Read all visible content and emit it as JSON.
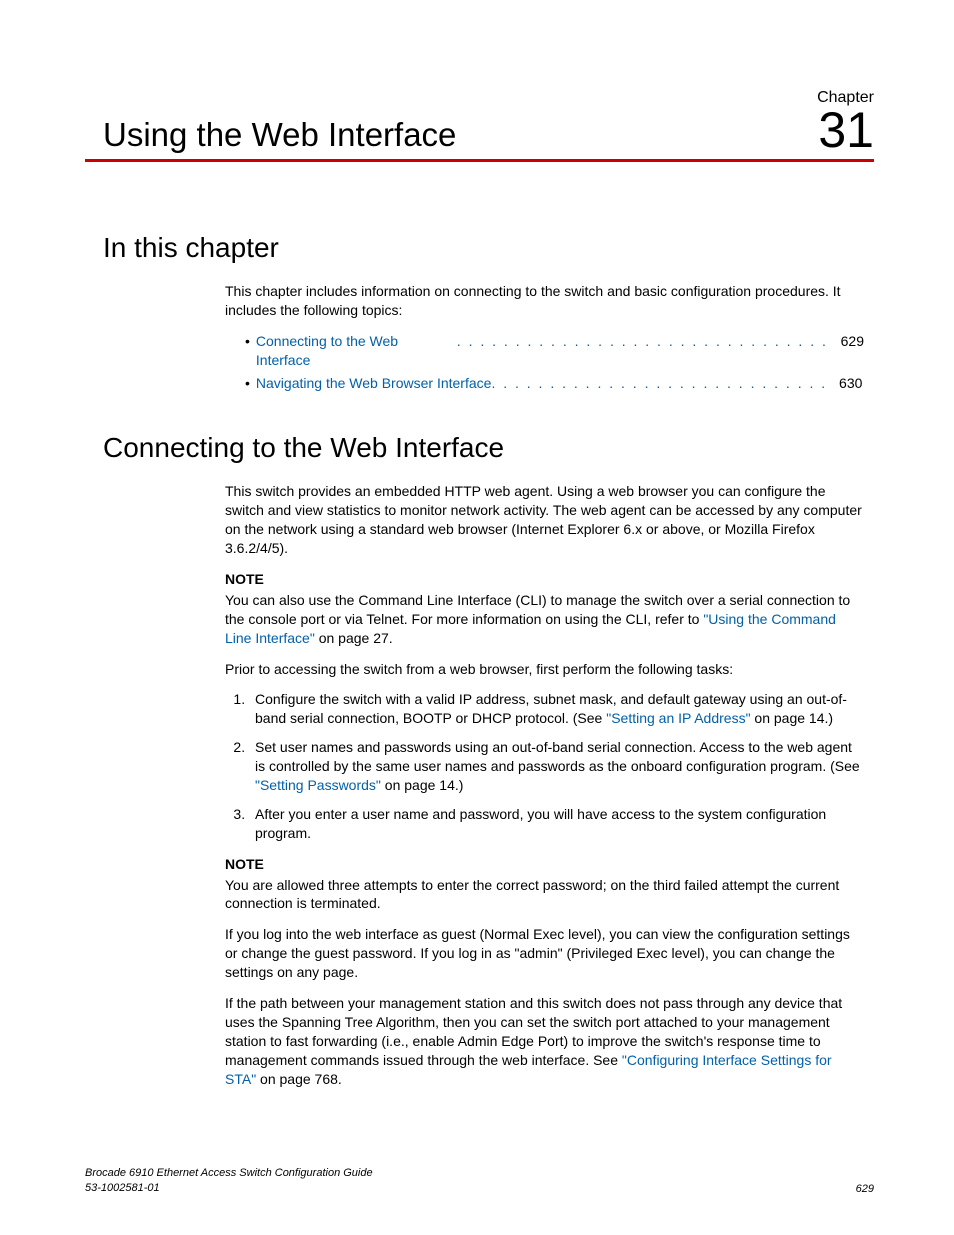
{
  "chapter": {
    "label": "Chapter",
    "number": "31",
    "title": "Using the Web Interface"
  },
  "sections": {
    "in_this_chapter": {
      "heading": "In this chapter",
      "intro": "This chapter includes information on connecting to the switch and basic configuration procedures. It includes the following topics:",
      "toc": [
        {
          "label": "Connecting to the Web Interface",
          "page": "629"
        },
        {
          "label": "Navigating the Web Browser Interface",
          "page": "630"
        }
      ]
    },
    "connecting": {
      "heading": "Connecting to the Web Interface",
      "para1": "This switch provides an embedded HTTP web agent. Using a web browser you can configure the switch and view statistics to monitor network activity. The web agent can be accessed by any computer on the network using a standard web browser (Internet Explorer 6.x or above, or Mozilla Firefox 3.6.2/4/5).",
      "note1": {
        "label": "NOTE",
        "text_before": "You can also use the Command Line Interface (CLI) to manage the switch over a serial connection to the console port or via Telnet. For more information on using the CLI, refer to ",
        "link": "\"Using the Command Line Interface\"",
        "text_after": " on page 27."
      },
      "para_prior": "Prior to accessing the switch from a web browser, first perform the following tasks:",
      "steps": {
        "s1a": "Configure the switch with a valid IP address, subnet mask, and default gateway using an out-of-band serial connection, BOOTP or DHCP protocol. (See ",
        "s1link": "\"Setting an IP Address\"",
        "s1b": " on page 14.)",
        "s2a": "Set user names and passwords using an out-of-band serial connection. Access to the web agent is controlled by the same user names and passwords as the onboard configuration program. (See ",
        "s2link": "\"Setting Passwords\"",
        "s2b": " on page 14.)",
        "s3": "After you enter a user name and password, you will have access to the system configuration program."
      },
      "note2": {
        "label": "NOTE",
        "text": "You are allowed three attempts to enter the correct password; on the third failed attempt the current connection is terminated."
      },
      "para_guest": "If you log into the web interface as guest (Normal Exec level), you can view the configuration settings or change the guest password. If you log in as \"admin\" (Privileged Exec level), you can change the settings on any page.",
      "para_sta_a": "If the path between your management station and this switch does not pass through any device that uses the Spanning Tree Algorithm, then you can set the switch port attached to your management station to fast forwarding (i.e., enable Admin Edge Port) to improve the switch's response time to management commands issued through the web interface. See ",
      "para_sta_link": "\"Configuring Interface Settings for STA\"",
      "para_sta_b": " on page 768."
    }
  },
  "footer": {
    "line1": "Brocade 6910 Ethernet Access Switch Configuration Guide",
    "line2": "53-1002581-01",
    "page": "629"
  }
}
